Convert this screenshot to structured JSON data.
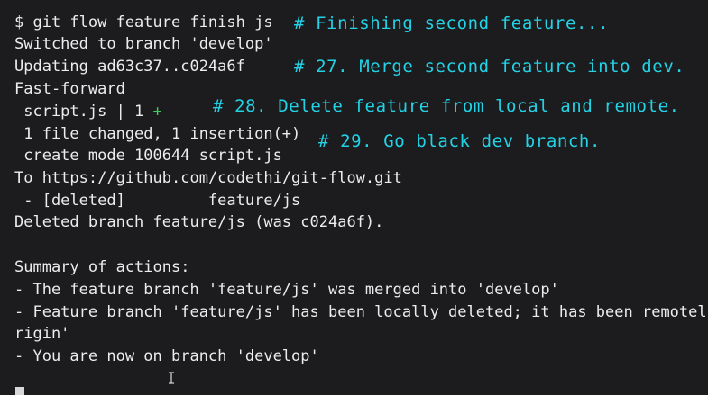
{
  "terminal": {
    "lines": {
      "l1": "$ git flow feature finish js",
      "l2": "Switched to branch 'develop'",
      "l3": "Updating ad63c37..c024a6f",
      "l4": "Fast-forward",
      "l5_text": " script.js | 1 ",
      "l5_plus": "+",
      "l6": " 1 file changed, 1 insertion(+)",
      "l7": " create mode 100644 script.js",
      "l8": "To https://github.com/codethi/git-flow.git",
      "l9": " - [deleted]         feature/js",
      "l10": "Deleted branch feature/js (was c024a6f).",
      "l11": "Summary of actions:",
      "l12": "- The feature branch 'feature/js' was merged into 'develop'",
      "l13": "- Feature branch 'feature/js' has been locally deleted; it has been remotel",
      "l14": "rigin'",
      "l15": "- You are now on branch 'develop'"
    },
    "comments": {
      "c1": "# Finishing second feature...",
      "c2": "# 27. Merge second feature into dev.",
      "c3": "# 28. Delete feature from local and remote.",
      "c4": "# 29. Go black dev branch."
    },
    "colors": {
      "background": "#1c1c1f",
      "text": "#ececec",
      "comment": "#22d3e6",
      "diff_plus": "#3fcf5a"
    }
  }
}
